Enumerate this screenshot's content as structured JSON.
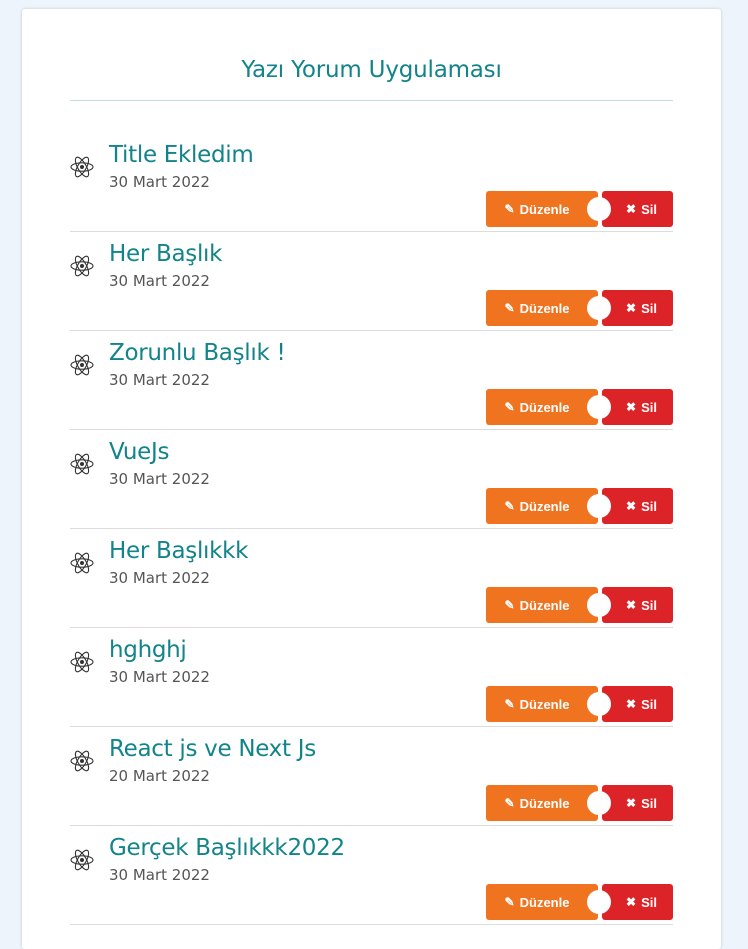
{
  "app": {
    "title": "Yazı Yorum Uygulaması"
  },
  "buttons": {
    "edit_label": "Düzenle",
    "delete_label": "Sil",
    "edit_icon": "pencil-icon",
    "delete_icon": "times-icon"
  },
  "colors": {
    "accent": "#12848a",
    "edit": "#f07320",
    "delete": "#dc2428"
  },
  "posts": [
    {
      "title": "Title Ekledim",
      "date": "30 Mart 2022"
    },
    {
      "title": "Her Başlık",
      "date": "30 Mart 2022"
    },
    {
      "title": "Zorunlu Başlık !",
      "date": "30 Mart 2022"
    },
    {
      "title": "VueJs",
      "date": "30 Mart 2022"
    },
    {
      "title": "Her Başlıkkk",
      "date": "30 Mart 2022"
    },
    {
      "title": "hghghj",
      "date": "30 Mart 2022"
    },
    {
      "title": "React js ve Next Js",
      "date": "20 Mart 2022"
    },
    {
      "title": "Gerçek Başlıkkk2022",
      "date": "30 Mart 2022"
    }
  ]
}
